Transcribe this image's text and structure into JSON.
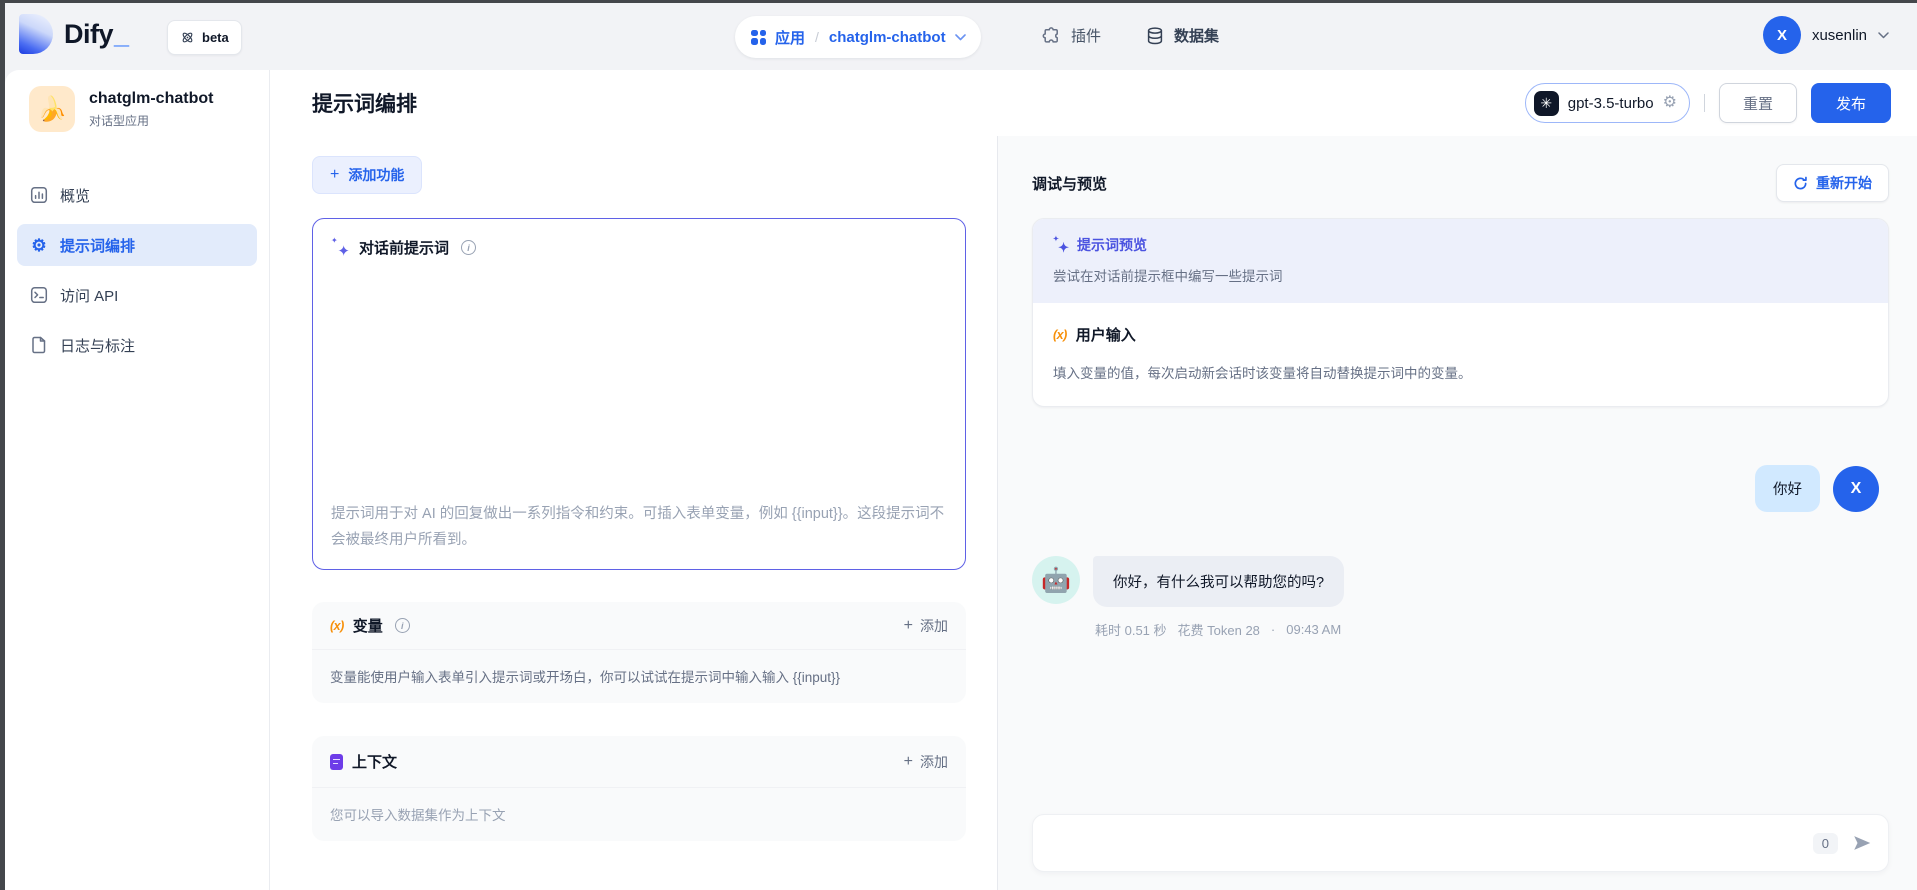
{
  "colors": {
    "primary_blue": "#2563eb",
    "indigo_accent": "#5f61e6",
    "preview_indigo": "#4b53e0",
    "orange_accent": "#f79009",
    "purple_accent": "#6d3ce8",
    "user_bubble_blue": "#d1e9ff",
    "bot_bubble_gray": "#ebeef4",
    "panel_gray": "#f9fafb"
  },
  "topbar": {
    "logo_text": "Dify",
    "logo_underscore": "_",
    "beta_label": "beta",
    "breadcrumb": {
      "section_label": "应用",
      "separator": "/",
      "app_name": "chatglm-chatbot"
    },
    "plugins_label": "插件",
    "datasets_label": "数据集",
    "user": {
      "initial": "X",
      "name": "xusenlin"
    }
  },
  "sidebar": {
    "app": {
      "emoji": "🍌",
      "name": "chatglm-chatbot",
      "type_label": "对话型应用"
    },
    "items": [
      {
        "label": "概览"
      },
      {
        "label": "提示词编排"
      },
      {
        "label": "访问 API"
      },
      {
        "label": "日志与标注"
      }
    ]
  },
  "header": {
    "title": "提示词编排",
    "model": {
      "name": "gpt-3.5-turbo"
    },
    "reset_label": "重置",
    "publish_label": "发布"
  },
  "editor": {
    "add_feature_label": "添加功能",
    "pre_prompt": {
      "title": "对话前提示词",
      "placeholder": "提示词用于对 AI 的回复做出一系列指令和约束。可插入表单变量，例如 {{input}}。这段提示词不会被最终用户所看到。"
    },
    "variables": {
      "title": "变量",
      "add_label": "添加",
      "description": "变量能使用户输入表单引入提示词或开场白，你可以试试在提示词中输入输入 {{input}}"
    },
    "context": {
      "title": "上下文",
      "add_label": "添加",
      "description": "您可以导入数据集作为上下文"
    }
  },
  "debug": {
    "title": "调试与预览",
    "restart_label": "重新开始",
    "prompt_preview": {
      "title": "提示词预览",
      "description": "尝试在对话前提示框中编写一些提示词"
    },
    "user_input": {
      "title": "用户输入",
      "description": "填入变量的值，每次启动新会话时该变量将自动替换提示词中的变量。"
    },
    "chat": {
      "user_message": {
        "text": "你好",
        "avatar_initial": "X"
      },
      "bot_message": {
        "emoji": "🤖",
        "text": "你好，有什么我可以帮助您的吗?",
        "meta_latency": "耗时 0.51 秒",
        "meta_tokens": "花费 Token 28",
        "meta_separator": "·",
        "meta_time": "09:43 AM"
      },
      "input": {
        "value": "",
        "counter": "0"
      }
    }
  },
  "icons": {
    "plus": "+",
    "info": "i",
    "sparkle": "✦",
    "sparkle_small": "✦",
    "gear": "⚙",
    "variable": "(x)",
    "openai": "✳"
  }
}
